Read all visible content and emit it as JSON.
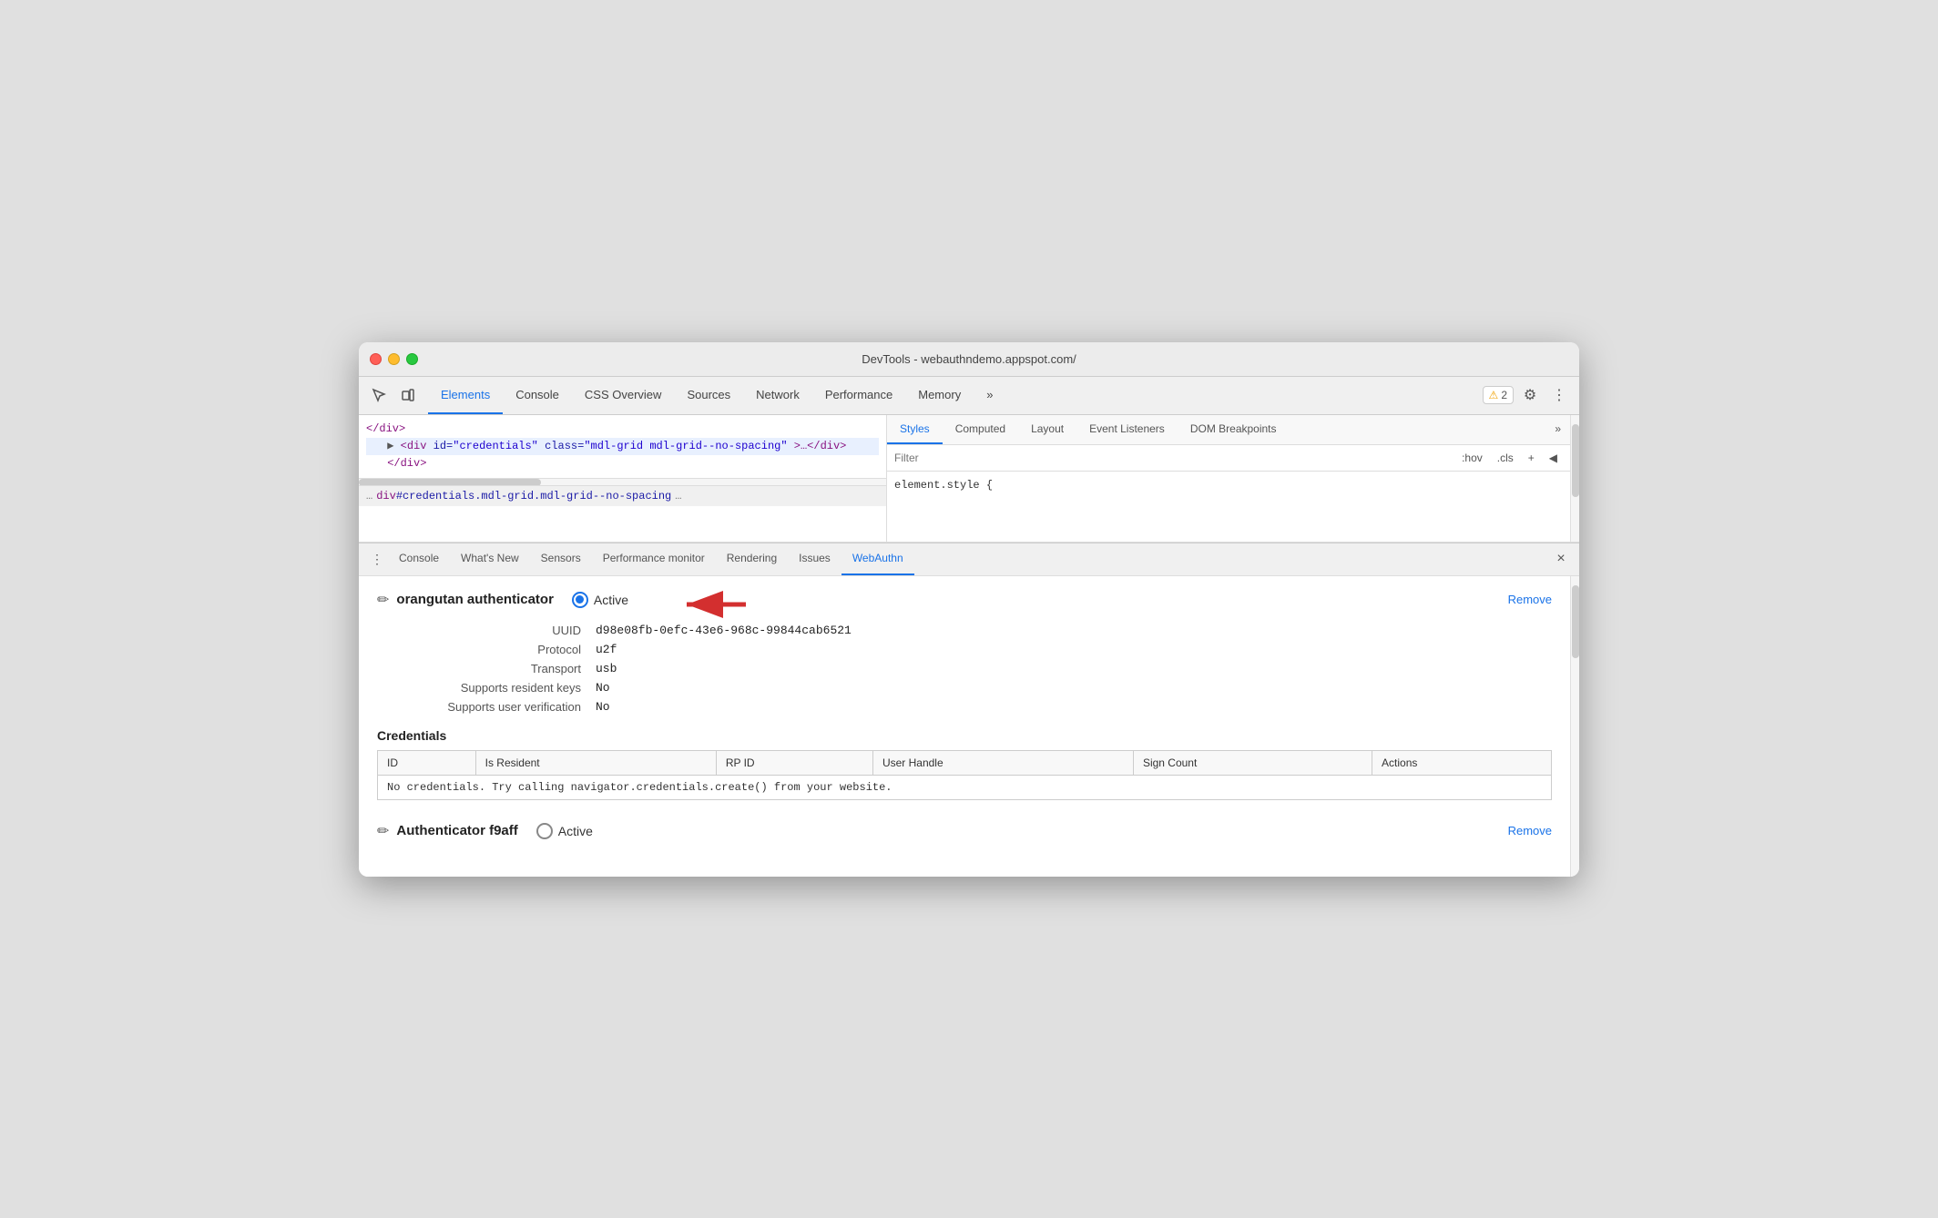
{
  "window": {
    "title": "DevTools - webauthndemo.appspot.com/"
  },
  "traffic_lights": {
    "red": "close",
    "yellow": "minimize",
    "green": "fullscreen"
  },
  "devtools_tabs": [
    {
      "label": "Elements",
      "active": true
    },
    {
      "label": "Console",
      "active": false
    },
    {
      "label": "CSS Overview",
      "active": false
    },
    {
      "label": "Sources",
      "active": false
    },
    {
      "label": "Network",
      "active": false
    },
    {
      "label": "Performance",
      "active": false
    },
    {
      "label": "Memory",
      "active": false
    },
    {
      "label": "»",
      "active": false
    }
  ],
  "toolbar_right": {
    "warning_icon": "⚠",
    "warning_count": "2",
    "settings_icon": "⚙",
    "more_icon": "⋮"
  },
  "elements_panel": {
    "lines": [
      {
        "html": "</div>",
        "indent": 0
      },
      {
        "html": "▶ <div id=\"credentials\" class=\"mdl-grid mdl-grid--no-spacing\">…</div>",
        "indent": 1,
        "selected": true
      },
      {
        "html": "</div>",
        "indent": 0
      }
    ],
    "breadcrumb": "div#credentials.mdl-grid.mdl-grid--no-spacing"
  },
  "styles_panel": {
    "tabs": [
      {
        "label": "Styles",
        "active": true
      },
      {
        "label": "Computed",
        "active": false
      },
      {
        "label": "Layout",
        "active": false
      },
      {
        "label": "Event Listeners",
        "active": false
      },
      {
        "label": "DOM Breakpoints",
        "active": false
      },
      {
        "label": "»",
        "active": false
      }
    ],
    "filter_placeholder": "Filter",
    "filter_buttons": [
      ":hov",
      ".cls",
      "+",
      "◀"
    ],
    "element_style": "element.style {"
  },
  "drawer": {
    "tabs": [
      {
        "label": "Console",
        "active": false
      },
      {
        "label": "What's New",
        "active": false
      },
      {
        "label": "Sensors",
        "active": false
      },
      {
        "label": "Performance monitor",
        "active": false
      },
      {
        "label": "Rendering",
        "active": false
      },
      {
        "label": "Issues",
        "active": false
      },
      {
        "label": "WebAuthn",
        "active": true
      }
    ],
    "close_label": "×"
  },
  "webauthn": {
    "authenticators": [
      {
        "name": "orangutan authenticator",
        "active": true,
        "uuid": "d98e08fb-0efc-43e6-968c-99844cab6521",
        "protocol": "u2f",
        "transport": "usb",
        "supports_resident_keys": "No",
        "supports_user_verification": "No",
        "remove_label": "Remove",
        "credentials_title": "Credentials",
        "table_headers": [
          "ID",
          "Is Resident",
          "RP ID",
          "User Handle",
          "Sign Count",
          "Actions"
        ],
        "no_credentials_msg": "No credentials. Try calling navigator.credentials.create() from your website.",
        "no_creds_code": "navigator.credentials.create()"
      },
      {
        "name": "Authenticator f9aff",
        "active": false,
        "remove_label": "Remove"
      }
    ],
    "labels": {
      "uuid": "UUID",
      "protocol": "Protocol",
      "transport": "Transport",
      "supports_resident_keys": "Supports resident keys",
      "supports_user_verification": "Supports user verification",
      "active": "Active",
      "edit_icon": "✏"
    }
  }
}
